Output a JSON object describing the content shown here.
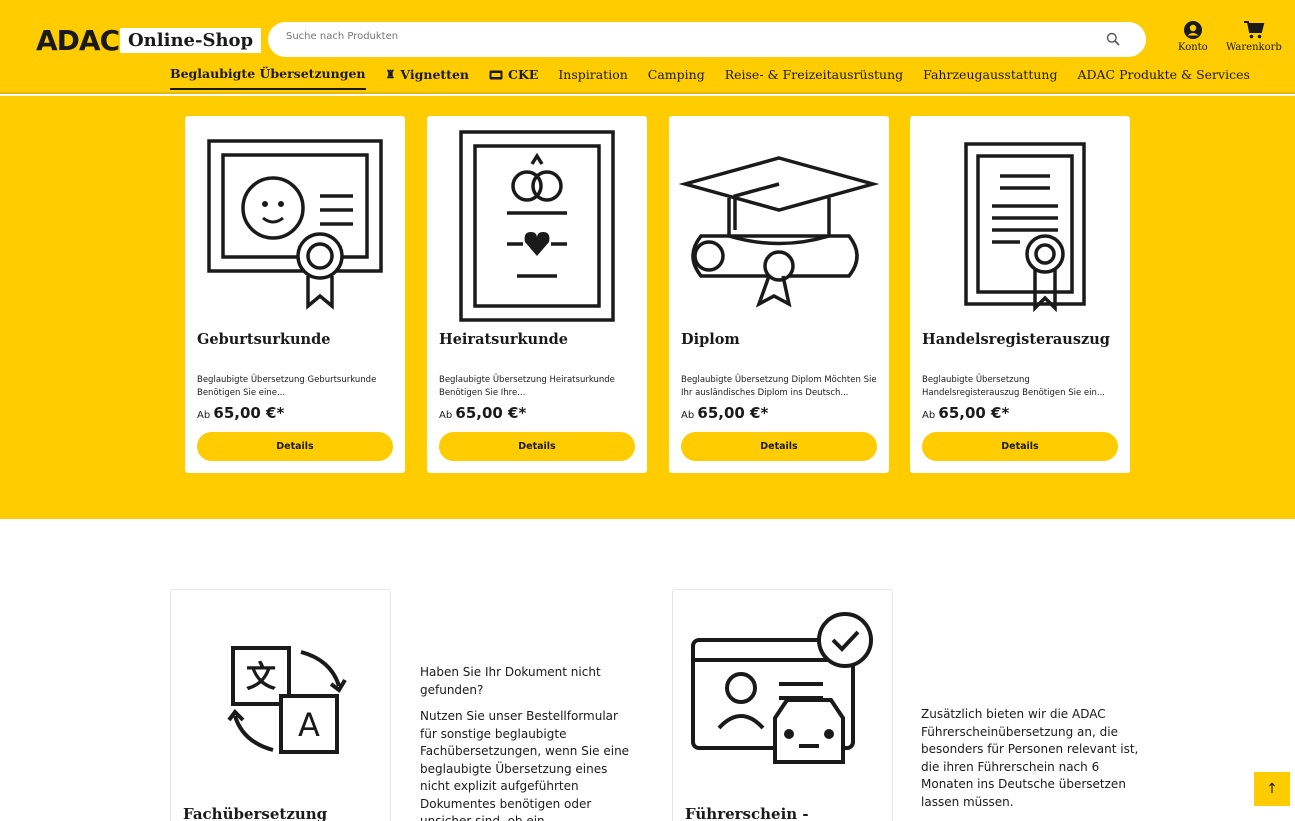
{
  "header": {
    "logo": "ADAC",
    "shop_label": "Online-Shop",
    "search_placeholder": "Suche nach Produkten",
    "account_label": "Konto",
    "cart_label": "Warenkorb"
  },
  "nav": [
    {
      "label": "Beglaubigte Übersetzungen",
      "icon": ""
    },
    {
      "label": "Vignetten",
      "icon": "vignette-icon"
    },
    {
      "label": "CKE",
      "icon": "cke-icon"
    },
    {
      "label": "Inspiration",
      "icon": ""
    },
    {
      "label": "Camping",
      "icon": ""
    },
    {
      "label": "Reise- & Freizeitausrüstung",
      "icon": ""
    },
    {
      "label": "Fahrzeugausstattung",
      "icon": ""
    },
    {
      "label": "ADAC Produkte & Services",
      "icon": ""
    }
  ],
  "products": [
    {
      "title": "Geburtsurkunde",
      "desc": "Beglaubigte Übersetzung Geburtsurkunde Benötigen Sie eine...",
      "price_prefix": "Ab",
      "price": "65,00 €*",
      "button": "Details"
    },
    {
      "title": "Heiratsurkunde",
      "desc": "Beglaubigte Übersetzung Heiratsurkunde Benötigen Sie Ihre...",
      "price_prefix": "Ab",
      "price": "65,00 €*",
      "button": "Details"
    },
    {
      "title": "Diplom",
      "desc": "Beglaubigte Übersetzung Diplom Möchten Sie Ihr ausländisches Diplom ins Deutsch...",
      "price_prefix": "Ab",
      "price": "65,00 €*",
      "button": "Details"
    },
    {
      "title": "Handelsregisterauszug",
      "desc": "Beglaubigte Übersetzung Handelsregisterauszug Benötigen Sie ein...",
      "price_prefix": "Ab",
      "price": "65,00 €*",
      "button": "Details"
    }
  ],
  "lower": {
    "card1_title": "Fachübersetzung",
    "text1_p1": "Haben Sie Ihr Dokument nicht gefunden?",
    "text1_p2": "Nutzen Sie unser Bestellformular für sonstige beglaubigte Fachübersetzungen, wenn Sie eine beglaubigte Übersetzung eines nicht explizit aufgeführten Dokumentes benötigen oder unsicher sind, ob ein",
    "card2_title": "Führerschein -",
    "text2": "Zusätzlich bieten wir die ADAC Führerscheinübersetzung an, die besonders für Personen relevant ist, die ihren Führerschein nach 6 Monaten ins Deutsche übersetzen lassen müssen."
  },
  "to_top_label": "↑",
  "colors": {
    "brand_yellow": "#ffcc00",
    "text": "#1a1a1a"
  }
}
